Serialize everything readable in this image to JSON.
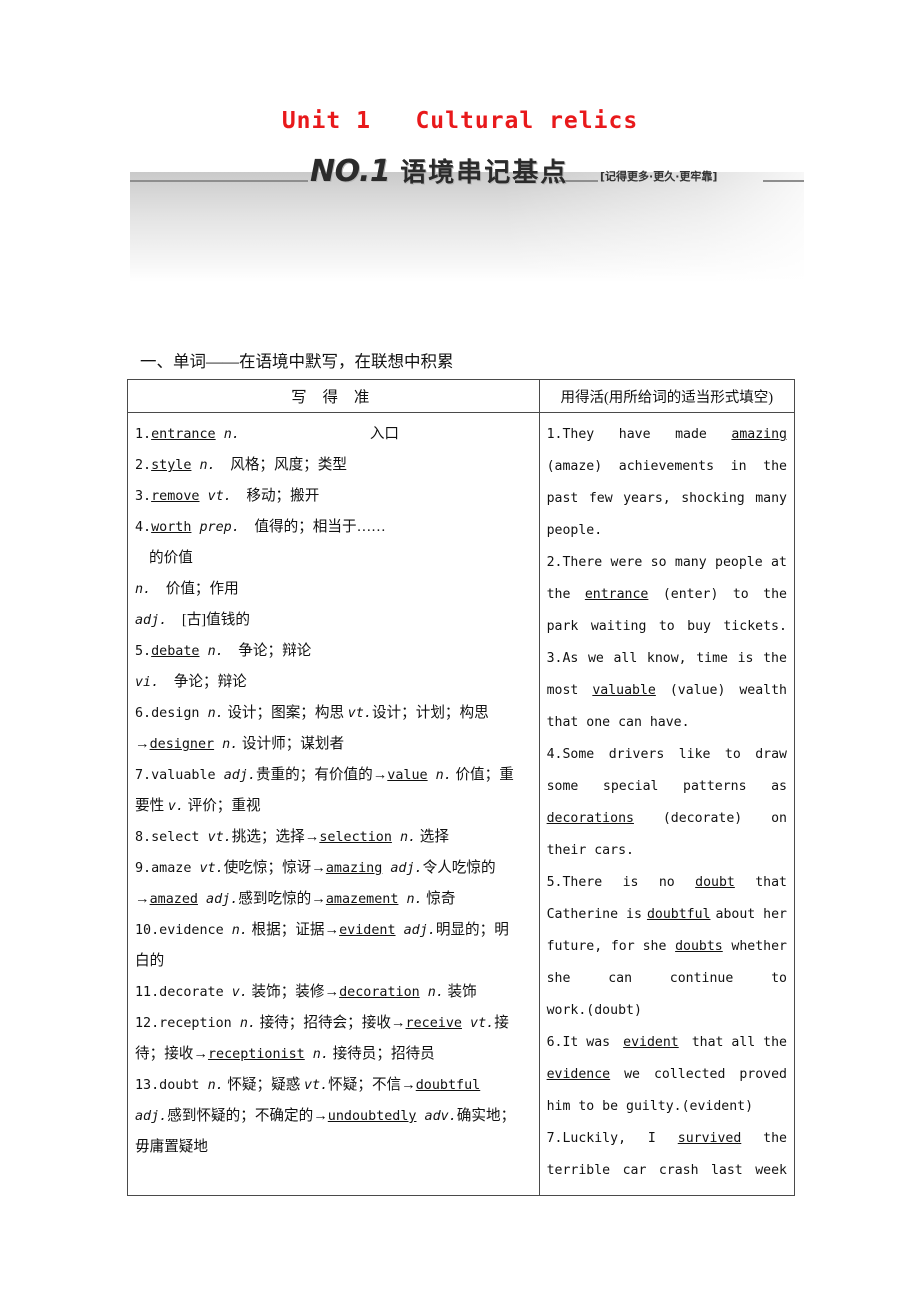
{
  "page": {
    "unit_title": "Unit 1   Cultural relics",
    "banner": {
      "no_label": "NO.1",
      "title_cn": "语境串记基点",
      "tagline": "[记得更多·更久·更牢靠]"
    },
    "section_heading": "一、单词——在语境中默写，在联想中积累",
    "accent_color": "#e8191b"
  },
  "table": {
    "headers": {
      "left": "写 得 准",
      "right": "用得活(用所给词的适当形式填空)"
    },
    "left_lines": [
      [
        {
          "t": "1."
        },
        {
          "t": "entrance",
          "s": "u"
        },
        {
          "t": " "
        },
        {
          "t": "n.",
          "s": "it"
        },
        {
          "t": "GAP"
        },
        {
          "t": "入口"
        }
      ],
      [
        {
          "t": "2."
        },
        {
          "t": "style",
          "s": "u"
        },
        {
          "t": " "
        },
        {
          "t": "n.",
          "s": "it"
        },
        {
          "t": "　风格；风度；类型"
        }
      ],
      [
        {
          "t": "3."
        },
        {
          "t": "remove",
          "s": "u"
        },
        {
          "t": " "
        },
        {
          "t": "vt.",
          "s": "it"
        },
        {
          "t": "　移动；搬开"
        }
      ],
      [
        {
          "t": "4."
        },
        {
          "t": "worth",
          "s": "u"
        },
        {
          "t": " "
        },
        {
          "t": "prep.",
          "s": "it"
        },
        {
          "t": "　值得的；相当于……"
        }
      ],
      [
        {
          "t": "IND"
        },
        {
          "t": "的价值"
        }
      ],
      [
        {
          "t": "n.",
          "s": "it"
        },
        {
          "t": "　价值；作用"
        }
      ],
      [
        {
          "t": "adj.",
          "s": "it"
        },
        {
          "t": "　[古]值钱的"
        }
      ],
      [
        {
          "t": "5."
        },
        {
          "t": "debate",
          "s": "u"
        },
        {
          "t": " "
        },
        {
          "t": "n.",
          "s": "it"
        },
        {
          "t": "　争论；辩论"
        }
      ],
      [
        {
          "t": "vi.",
          "s": "it"
        },
        {
          "t": "　争论；辩论"
        }
      ],
      [
        {
          "t": "6.design "
        },
        {
          "t": "n.",
          "s": "it"
        },
        {
          "t": " 设计；图案；构思 "
        },
        {
          "t": "vt.",
          "s": "it"
        },
        {
          "t": "设计；计划；构思"
        }
      ],
      [
        {
          "t": "→"
        },
        {
          "t": "designer",
          "s": "u"
        },
        {
          "t": " "
        },
        {
          "t": "n.",
          "s": "it"
        },
        {
          "t": " 设计师；谋划者"
        }
      ],
      [
        {
          "t": "7.valuable "
        },
        {
          "t": "adj.",
          "s": "it"
        },
        {
          "t": "贵重的；有价值的→"
        },
        {
          "t": "value",
          "s": "u"
        },
        {
          "t": " "
        },
        {
          "t": "n.",
          "s": "it"
        },
        {
          "t": " 价值；重"
        }
      ],
      [
        {
          "t": "要性 "
        },
        {
          "t": "v.",
          "s": "it"
        },
        {
          "t": " 评价；重视"
        }
      ],
      [
        {
          "t": "8.select "
        },
        {
          "t": "vt.",
          "s": "it"
        },
        {
          "t": "挑选；选择→"
        },
        {
          "t": "selection",
          "s": "u"
        },
        {
          "t": " "
        },
        {
          "t": "n.",
          "s": "it"
        },
        {
          "t": " 选择"
        }
      ],
      [
        {
          "t": "9.amaze "
        },
        {
          "t": "vt.",
          "s": "it"
        },
        {
          "t": "使吃惊；惊讶→"
        },
        {
          "t": "amazing",
          "s": "u"
        },
        {
          "t": " "
        },
        {
          "t": "adj.",
          "s": "it"
        },
        {
          "t": "令人吃惊的"
        }
      ],
      [
        {
          "t": "→"
        },
        {
          "t": "amazed",
          "s": "u"
        },
        {
          "t": " "
        },
        {
          "t": "adj.",
          "s": "it"
        },
        {
          "t": "感到吃惊的→"
        },
        {
          "t": "amazement",
          "s": "u"
        },
        {
          "t": " "
        },
        {
          "t": "n.",
          "s": "it"
        },
        {
          "t": " 惊奇"
        }
      ],
      [
        {
          "t": "10.evidence "
        },
        {
          "t": "n.",
          "s": "it"
        },
        {
          "t": " 根据；证据→"
        },
        {
          "t": "evident",
          "s": "u"
        },
        {
          "t": " "
        },
        {
          "t": "adj.",
          "s": "it"
        },
        {
          "t": "明显的；明"
        }
      ],
      [
        {
          "t": "白的"
        }
      ],
      [
        {
          "t": "11.decorate "
        },
        {
          "t": "v.",
          "s": "it"
        },
        {
          "t": " 装饰；装修→"
        },
        {
          "t": "decoration",
          "s": "u"
        },
        {
          "t": " "
        },
        {
          "t": "n.",
          "s": "it"
        },
        {
          "t": " 装饰"
        }
      ],
      [
        {
          "t": "12.reception "
        },
        {
          "t": "n.",
          "s": "it"
        },
        {
          "t": " 接待；招待会；接收→"
        },
        {
          "t": "receive",
          "s": "u"
        },
        {
          "t": " "
        },
        {
          "t": "vt.",
          "s": "it"
        },
        {
          "t": "接"
        }
      ],
      [
        {
          "t": "待；接收→"
        },
        {
          "t": "receptionist",
          "s": "u"
        },
        {
          "t": " "
        },
        {
          "t": "n.",
          "s": "it"
        },
        {
          "t": " 接待员；招待员"
        }
      ],
      [
        {
          "t": "13.doubt "
        },
        {
          "t": "n.",
          "s": "it"
        },
        {
          "t": " 怀疑；疑惑 "
        },
        {
          "t": "vt.",
          "s": "it"
        },
        {
          "t": "怀疑；不信→"
        },
        {
          "t": "doubtful",
          "s": "u"
        }
      ],
      [
        {
          "t": "adj.",
          "s": "it"
        },
        {
          "t": "感到怀疑的；不确定的→"
        },
        {
          "t": "undoubtedly",
          "s": "u"
        },
        {
          "t": " "
        },
        {
          "t": "adv.",
          "s": "it"
        },
        {
          "t": "确实地；"
        }
      ],
      [
        {
          "t": "毋庸置疑地"
        }
      ]
    ],
    "right_lines": [
      {
        "justify": true,
        "parts": [
          {
            "t": "1.They"
          },
          {
            "t": "have"
          },
          {
            "t": "made"
          },
          {
            "t": "amazing",
            "s": "u"
          }
        ]
      },
      {
        "justify": true,
        "parts": [
          {
            "t": "(amaze)"
          },
          {
            "t": "achievements"
          },
          {
            "t": "in"
          },
          {
            "t": "the"
          }
        ]
      },
      {
        "justify": true,
        "parts": [
          {
            "t": "past"
          },
          {
            "t": "few"
          },
          {
            "t": "years,"
          },
          {
            "t": "shocking"
          },
          {
            "t": "many"
          }
        ]
      },
      {
        "justify": false,
        "parts": [
          {
            "t": "people."
          }
        ]
      },
      {
        "justify": true,
        "parts": [
          {
            "t": "2.There"
          },
          {
            "t": "were"
          },
          {
            "t": "so"
          },
          {
            "t": "many"
          },
          {
            "t": "people"
          },
          {
            "t": "at"
          }
        ]
      },
      {
        "justify": true,
        "parts": [
          {
            "t": "the"
          },
          {
            "t": "entrance",
            "s": "u"
          },
          {
            "t": "(enter)"
          },
          {
            "t": "to"
          },
          {
            "t": "the"
          }
        ]
      },
      {
        "justify": true,
        "parts": [
          {
            "t": "park"
          },
          {
            "t": "waiting"
          },
          {
            "t": "to"
          },
          {
            "t": "buy"
          },
          {
            "t": "tickets."
          }
        ]
      },
      {
        "justify": true,
        "parts": [
          {
            "t": "3.As"
          },
          {
            "t": "we"
          },
          {
            "t": "all"
          },
          {
            "t": "know,"
          },
          {
            "t": "time"
          },
          {
            "t": "is"
          },
          {
            "t": "the"
          }
        ]
      },
      {
        "justify": true,
        "parts": [
          {
            "t": "most"
          },
          {
            "t": "valuable",
            "s": "u"
          },
          {
            "t": "(value)"
          },
          {
            "t": "wealth"
          }
        ]
      },
      {
        "justify": false,
        "parts": [
          {
            "t": "that one can have."
          }
        ]
      },
      {
        "justify": true,
        "parts": [
          {
            "t": "4.Some"
          },
          {
            "t": "drivers"
          },
          {
            "t": "like"
          },
          {
            "t": "to"
          },
          {
            "t": "draw"
          }
        ]
      },
      {
        "justify": true,
        "parts": [
          {
            "t": "some"
          },
          {
            "t": "special"
          },
          {
            "t": "patterns"
          },
          {
            "t": "as"
          }
        ]
      },
      {
        "justify": true,
        "parts": [
          {
            "t": "decorations",
            "s": "u"
          },
          {
            "t": "(decorate)"
          },
          {
            "t": "on"
          }
        ]
      },
      {
        "justify": false,
        "parts": [
          {
            "t": "their cars."
          }
        ]
      },
      {
        "justify": true,
        "parts": [
          {
            "t": "5.There"
          },
          {
            "t": "is"
          },
          {
            "t": "no"
          },
          {
            "t": "doubt",
            "s": "u"
          },
          {
            "t": "that"
          }
        ]
      },
      {
        "justify": true,
        "parts": [
          {
            "t": "Catherine is"
          },
          {
            "t": "doubtful",
            "s": "u"
          },
          {
            "t": "about her"
          }
        ]
      },
      {
        "justify": true,
        "parts": [
          {
            "t": "future,"
          },
          {
            "t": "for she"
          },
          {
            "t": "doubts",
            "s": "u"
          },
          {
            "t": "whether"
          }
        ]
      },
      {
        "justify": true,
        "parts": [
          {
            "t": "she"
          },
          {
            "t": "can"
          },
          {
            "t": "continue"
          },
          {
            "t": "to"
          }
        ]
      },
      {
        "justify": false,
        "parts": [
          {
            "t": "work.(doubt)"
          }
        ]
      },
      {
        "justify": true,
        "parts": [
          {
            "t": "6.It was"
          },
          {
            "t": "evident",
            "s": "u"
          },
          {
            "t": "that all the"
          }
        ]
      },
      {
        "justify": true,
        "parts": [
          {
            "t": "evidence",
            "s": "u"
          },
          {
            "t": "we"
          },
          {
            "t": "collected"
          },
          {
            "t": "proved"
          }
        ]
      },
      {
        "justify": false,
        "parts": [
          {
            "t": "him to be guilty.(evident)"
          }
        ]
      },
      {
        "justify": true,
        "parts": [
          {
            "t": "7.Luckily,"
          },
          {
            "t": "I"
          },
          {
            "t": "survived",
            "s": "u"
          },
          {
            "t": "the"
          }
        ]
      },
      {
        "justify": true,
        "parts": [
          {
            "t": "terrible"
          },
          {
            "t": "car"
          },
          {
            "t": "crash"
          },
          {
            "t": "last"
          },
          {
            "t": "week"
          }
        ]
      }
    ]
  }
}
